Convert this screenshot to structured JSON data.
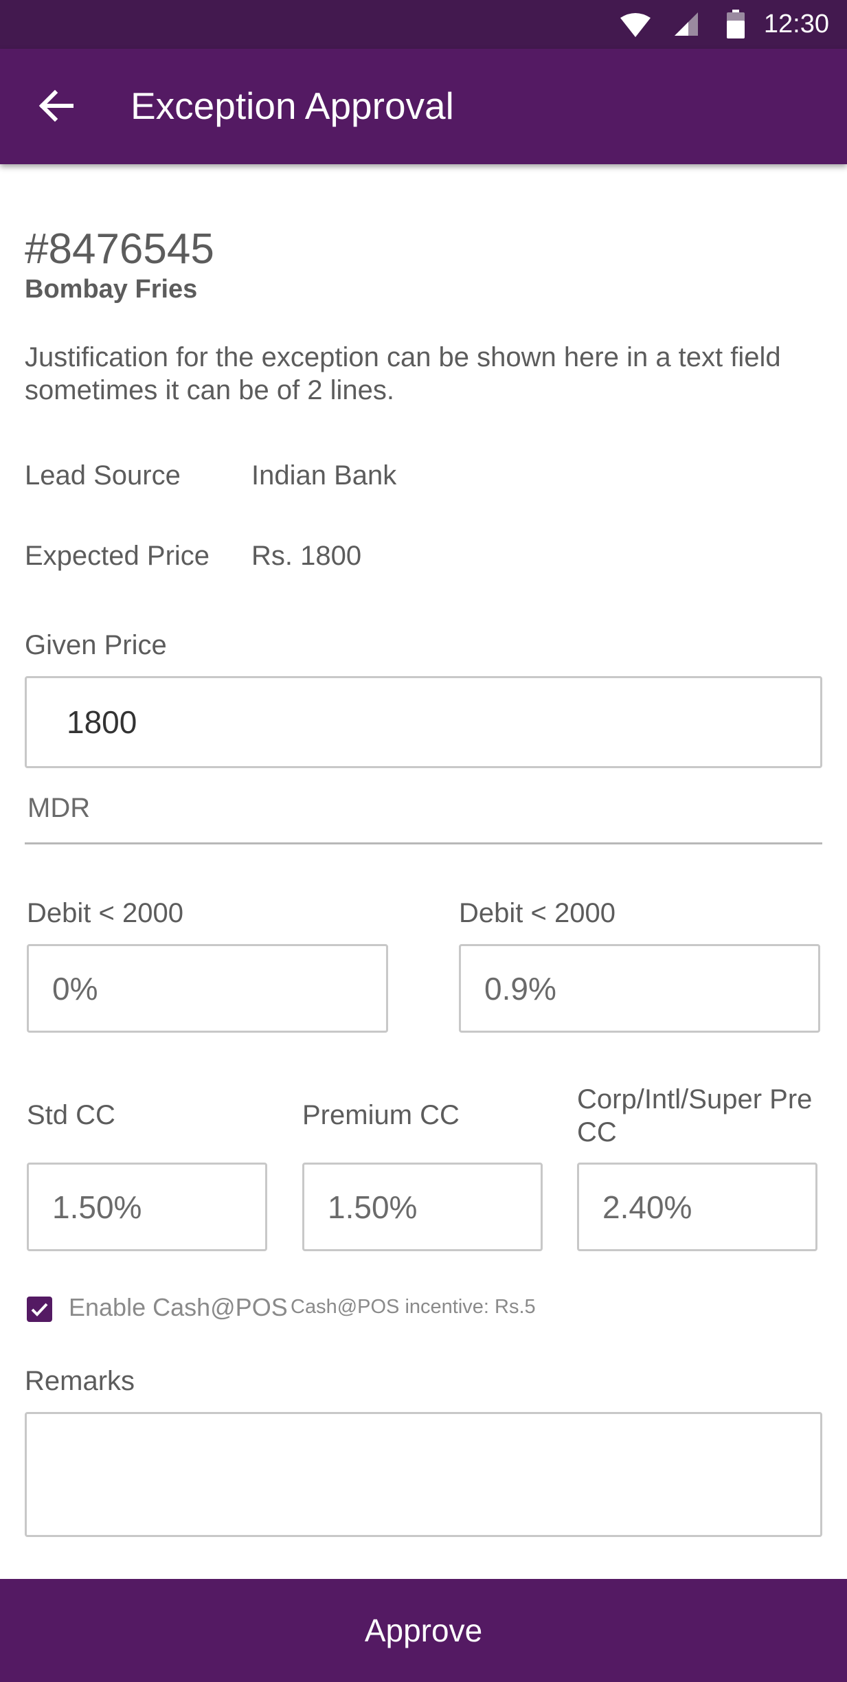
{
  "status_bar": {
    "time": "12:30"
  },
  "header": {
    "title": "Exception Approval"
  },
  "ticket": {
    "id": "#8476545",
    "merchant": "Bombay Fries",
    "justification": "Justification for the exception can be shown here in a text field sometimes it can be of 2 lines."
  },
  "details": [
    {
      "label": "Lead Source",
      "value": "Indian Bank"
    },
    {
      "label": "Expected Price",
      "value": "Rs. 1800"
    }
  ],
  "given_price": {
    "label": "Given Price",
    "value": "1800"
  },
  "mdr": {
    "label": "MDR",
    "debit": [
      {
        "label": "Debit < 2000",
        "value": "0%"
      },
      {
        "label": "Debit < 2000",
        "value": "0.9%"
      }
    ],
    "cards": [
      {
        "label": "Std CC",
        "value": "1.50%"
      },
      {
        "label": "Premium CC",
        "value": "1.50%"
      },
      {
        "label": "Corp/Intl/Super Pre CC",
        "value": "2.40%"
      }
    ]
  },
  "cash_pos": {
    "label": "Enable Cash@POS",
    "checked": true,
    "incentive_label": "Cash@POS incentive:",
    "incentive_value": "Rs.5"
  },
  "remarks": {
    "label": "Remarks",
    "value": ""
  },
  "footer": {
    "approve_label": "Approve"
  },
  "colors": {
    "primary": "#541a63",
    "status_bar": "#43194f",
    "field_border": "#c8c8c8"
  }
}
